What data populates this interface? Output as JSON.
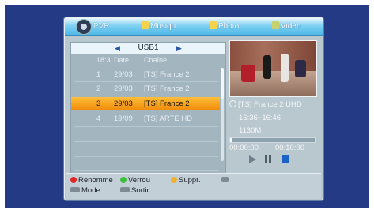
{
  "tabs": [
    {
      "label": "PVR",
      "icon": "disc-icon"
    },
    {
      "label": "Musiqu",
      "icon": "music-note-icon"
    },
    {
      "label": "Photo",
      "icon": "photo-icon"
    },
    {
      "label": "Vidéo",
      "icon": "film-icon"
    }
  ],
  "list": {
    "source": "USB1",
    "columns": [
      "18:3",
      "Date",
      "Chaîne"
    ],
    "rows": [
      {
        "num": "1",
        "date": "29/03",
        "channel": "[TS] France 2"
      },
      {
        "num": "2",
        "date": "29/03",
        "channel": "[TS] France 2"
      },
      {
        "num": "3",
        "date": "29/03",
        "channel": "[TS] France 2"
      },
      {
        "num": "4",
        "date": "19/09",
        "channel": "[TS] ARTE HD"
      }
    ],
    "selected_index": 2
  },
  "info": {
    "channel": "[TS] France 2 UHD",
    "time_range": "16:36~16:46",
    "size": "1130M",
    "elapsed": "00:00:00",
    "total": "00:10:00",
    "progress": 0.02
  },
  "footer": {
    "rename": "Renomme",
    "lock": "Verrou",
    "delete": "Suppr.",
    "mode": "Mode",
    "exit": "Sortir"
  },
  "colors": {
    "accent_selection": "#f5a21e",
    "red": "#e02828",
    "green": "#3cc03c",
    "yellow": "#f0b030",
    "blue": "#1b62c8"
  }
}
